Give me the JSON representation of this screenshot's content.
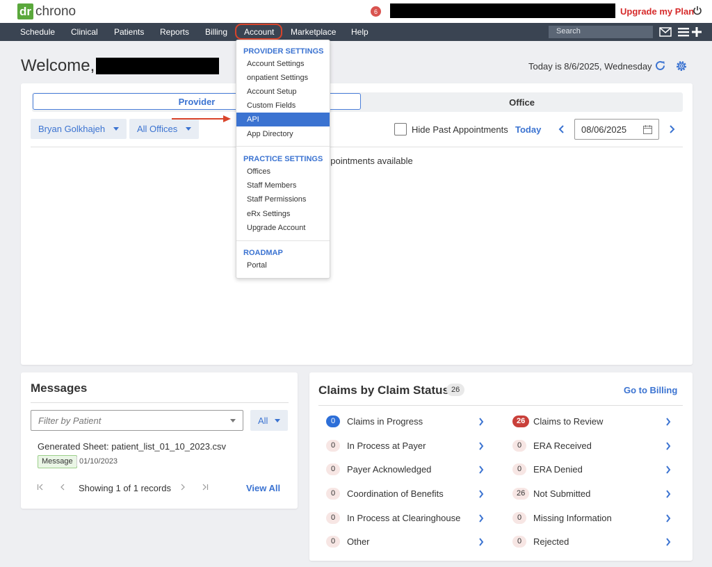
{
  "app": {
    "logo_mark": "dr",
    "logo_text": "chrono",
    "notification_count": "6",
    "upgrade_label": "Upgrade my Plan"
  },
  "nav": {
    "items": [
      "Schedule",
      "Clinical",
      "Patients",
      "Reports",
      "Billing",
      "Account",
      "Marketplace",
      "Help"
    ],
    "search_placeholder": "Search"
  },
  "header": {
    "welcome": "Welcome,",
    "today": "Today is 8/6/2025, Wednesday"
  },
  "appointments": {
    "tabs": [
      "Provider",
      "Office"
    ],
    "provider_filter": "Bryan Golkhajeh",
    "office_filter": "All Offices",
    "hide_past_label": "Hide Past Appointments",
    "today_label": "Today",
    "date_value": "08/06/2025",
    "empty_text": "ppointments available"
  },
  "account_menu": {
    "provider_header": "PROVIDER SETTINGS",
    "provider_items": [
      "Account Settings",
      "onpatient Settings",
      "Account Setup",
      "Custom Fields",
      "API",
      "App Directory"
    ],
    "practice_header": "PRACTICE SETTINGS",
    "practice_items": [
      "Offices",
      "Staff Members",
      "Staff Permissions",
      "eRx Settings",
      "Upgrade Account"
    ],
    "roadmap_header": "ROADMAP",
    "roadmap_items": [
      "Portal"
    ],
    "active_item": "API"
  },
  "messages": {
    "title": "Messages",
    "filter_placeholder": "Filter by Patient",
    "filter_all": "All",
    "item_subject": "Generated Sheet: patient_list_01_10_2023.csv",
    "item_tag": "Message",
    "item_date": "01/10/2023",
    "pager_text": "Showing 1 of 1 records",
    "view_all": "View All"
  },
  "claims": {
    "title": "Claims by Claim Status",
    "total": "26",
    "go_billing": "Go to Billing",
    "left": [
      {
        "count": "0",
        "label": "Claims in Progress",
        "style": "blue"
      },
      {
        "count": "0",
        "label": "In Process at Payer",
        "style": "plain"
      },
      {
        "count": "0",
        "label": "Payer Acknowledged",
        "style": "plain"
      },
      {
        "count": "0",
        "label": "Coordination of Benefits",
        "style": "plain"
      },
      {
        "count": "0",
        "label": "In Process at Clearinghouse",
        "style": "plain"
      },
      {
        "count": "0",
        "label": "Other",
        "style": "plain"
      }
    ],
    "right": [
      {
        "count": "26",
        "label": "Claims to Review",
        "style": "red"
      },
      {
        "count": "0",
        "label": "ERA Received",
        "style": "plain"
      },
      {
        "count": "0",
        "label": "ERA Denied",
        "style": "plain"
      },
      {
        "count": "26",
        "label": "Not Submitted",
        "style": "plain"
      },
      {
        "count": "0",
        "label": "Missing Information",
        "style": "plain"
      },
      {
        "count": "0",
        "label": "Rejected",
        "style": "plain"
      }
    ]
  },
  "colors": {
    "brand_green": "#5aa83c",
    "nav_bg": "#3a4452",
    "accent_blue": "#3b73d1",
    "alert_red": "#d62b2b",
    "annotation_red": "#d9442b"
  }
}
